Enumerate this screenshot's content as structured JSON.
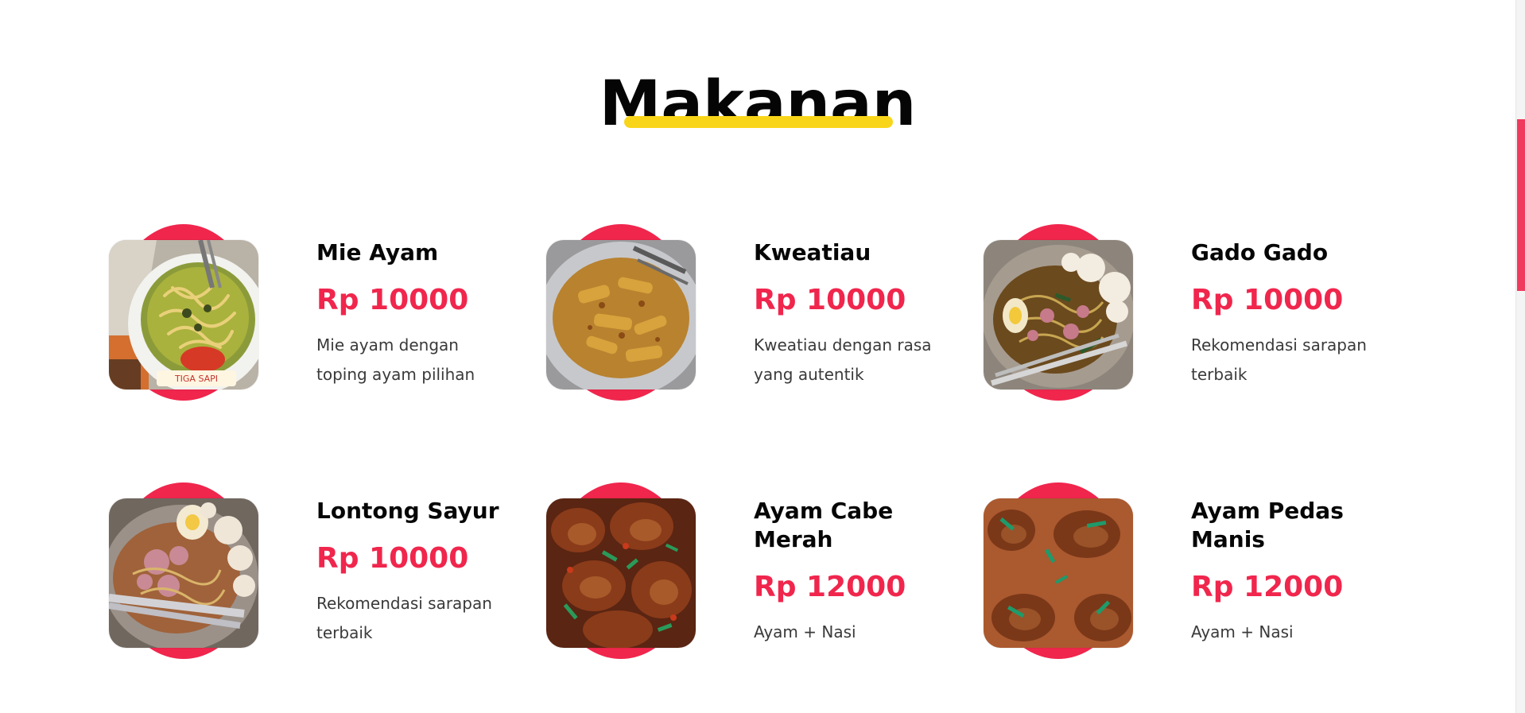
{
  "section": {
    "title": "Makanan"
  },
  "colors": {
    "accent": "#f0264d",
    "underline": "#f9d51a",
    "text": "#111111"
  },
  "menu": [
    {
      "name": "Mie Ayam",
      "price": "Rp 10000",
      "desc_line1": "Mie ayam dengan",
      "desc_line2": "toping ayam pilihan",
      "image_icon": "mie-ayam-photo"
    },
    {
      "name": "Kweatiau",
      "price": "Rp 10000",
      "desc_line1": "Kweatiau dengan rasa",
      "desc_line2": "yang autentik",
      "image_icon": "kweatiau-photo"
    },
    {
      "name": "Gado Gado",
      "price": "Rp 10000",
      "desc_line1": "Rekomendasi sarapan",
      "desc_line2": "terbaik",
      "image_icon": "gado-gado-photo"
    },
    {
      "name": "Lontong Sayur",
      "price": "Rp 10000",
      "desc_line1": "Rekomendasi sarapan",
      "desc_line2": "terbaik",
      "image_icon": "lontong-sayur-photo"
    },
    {
      "name_line1": "Ayam Cabe",
      "name_line2": "Merah",
      "price": "Rp 12000",
      "desc_line1": "Ayam + Nasi",
      "image_icon": "ayam-cabe-merah-photo"
    },
    {
      "name_line1": "Ayam Pedas",
      "name_line2": "Manis",
      "price": "Rp 12000",
      "desc_line1": "Ayam + Nasi",
      "image_icon": "ayam-pedas-manis-photo"
    }
  ]
}
